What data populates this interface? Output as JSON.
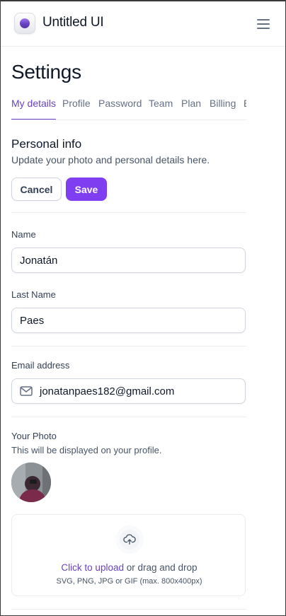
{
  "app": {
    "brand": "Untitled UI"
  },
  "page": {
    "title": "Settings"
  },
  "tabs": [
    {
      "label": "My details",
      "active": true
    },
    {
      "label": "Profile"
    },
    {
      "label": "Password"
    },
    {
      "label": "Team"
    },
    {
      "label": "Plan"
    },
    {
      "label": "Billing"
    },
    {
      "label": "E"
    }
  ],
  "personal_info": {
    "title": "Personal info",
    "subtitle": "Update your photo and personal details here.",
    "cancel_label": "Cancel",
    "save_label": "Save"
  },
  "form": {
    "name_label": "Name",
    "name_value": "Jonatán",
    "last_name_label": "Last Name",
    "last_name_value": "Paes",
    "email_label": "Email address",
    "email_value": "jonatanpaes182@gmail.com"
  },
  "photo": {
    "label": "Your Photo",
    "subtitle": "This will be displayed on your profile."
  },
  "upload": {
    "link_text": "Click to upload",
    "rest_text": " or drag and drop",
    "hint": "SVG, PNG, JPG or GIF (max. 800x400px)"
  },
  "colors": {
    "accent": "#7f3ff0",
    "accent_text": "#6941c6",
    "border": "#d0d5dd",
    "divider": "#eaecf0"
  },
  "icons": [
    "logo-icon",
    "hamburger-menu-icon",
    "mail-icon",
    "upload-cloud-icon"
  ]
}
